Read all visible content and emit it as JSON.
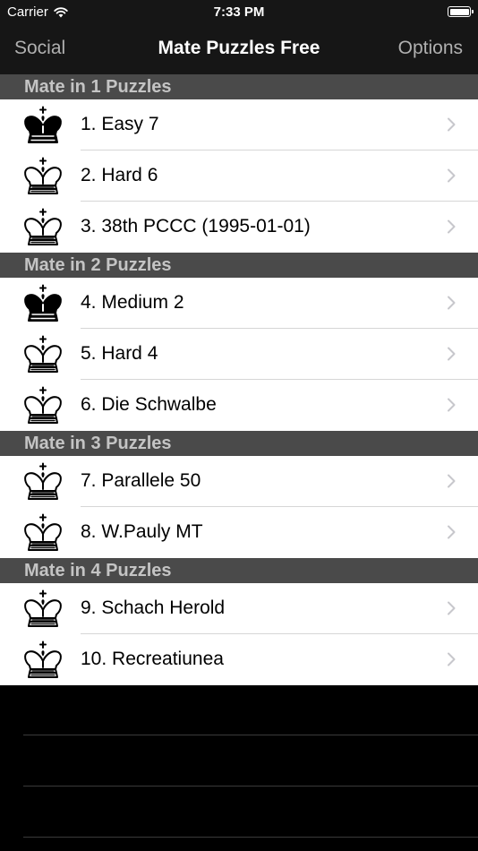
{
  "status_bar": {
    "carrier": "Carrier",
    "time": "7:33 PM",
    "battery": 1.0
  },
  "nav": {
    "left": "Social",
    "title": "Mate Puzzles Free",
    "right": "Options"
  },
  "sections": [
    {
      "title": "Mate in 1 Puzzles",
      "items": [
        {
          "label": "1. Easy 7",
          "icon": "black-king-icon"
        },
        {
          "label": "2. Hard 6",
          "icon": "white-king-icon"
        },
        {
          "label": "3. 38th PCCC (1995-01-01)",
          "icon": "white-king-icon"
        }
      ]
    },
    {
      "title": "Mate in 2 Puzzles",
      "items": [
        {
          "label": "4. Medium 2",
          "icon": "black-king-icon"
        },
        {
          "label": "5. Hard 4",
          "icon": "white-king-icon"
        },
        {
          "label": "6. Die Schwalbe",
          "icon": "white-king-icon"
        }
      ]
    },
    {
      "title": "Mate in 3 Puzzles",
      "items": [
        {
          "label": "7. Parallele 50",
          "icon": "white-king-icon"
        },
        {
          "label": "8. W.Pauly MT",
          "icon": "white-king-icon"
        }
      ]
    },
    {
      "title": "Mate in 4 Puzzles",
      "items": [
        {
          "label": "9. Schach Herold",
          "icon": "white-king-icon"
        },
        {
          "label": "10. Recreatiunea",
          "icon": "white-king-icon"
        }
      ]
    }
  ],
  "colors": {
    "bar_background": "#161616",
    "section_header": "#4a4a4a",
    "section_text": "#c4c4c4",
    "nav_button": "#b0b0b0",
    "chevron": "#c7c7cc"
  }
}
